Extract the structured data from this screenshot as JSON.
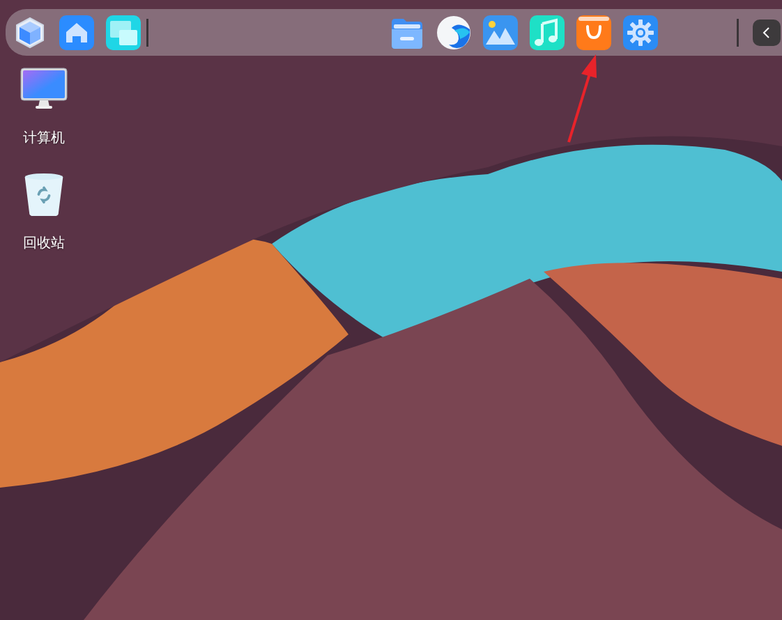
{
  "dock": {
    "left_apps": [
      {
        "kind": "cube"
      },
      {
        "kind": "home"
      },
      {
        "kind": "windows"
      }
    ],
    "right_apps": [
      {
        "kind": "files"
      },
      {
        "kind": "browser"
      },
      {
        "kind": "photos"
      },
      {
        "kind": "music"
      },
      {
        "kind": "store"
      },
      {
        "kind": "settings"
      }
    ],
    "collapse_button": {
      "kind": "chevron-left"
    }
  },
  "desktop_icons": [
    {
      "kind": "computer",
      "label": "计算机"
    },
    {
      "kind": "trash",
      "label": "回收站"
    }
  ],
  "annotation": {
    "kind": "arrow"
  }
}
